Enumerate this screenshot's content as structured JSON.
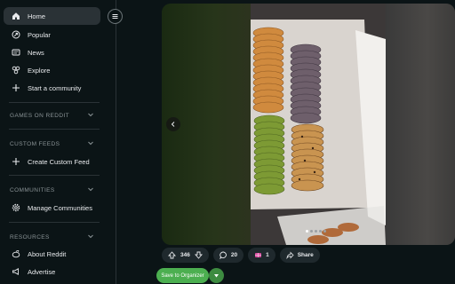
{
  "nav": {
    "home": "Home",
    "popular": "Popular",
    "news": "News",
    "explore": "Explore",
    "start_community": "Start a community"
  },
  "sections": {
    "games": "GAMES ON REDDIT",
    "custom_feeds": "CUSTOM FEEDS",
    "communities": "COMMUNITIES",
    "resources": "RESOURCES"
  },
  "custom_feeds": {
    "create": "Create Custom Feed"
  },
  "communities": {
    "manage": "Manage Communities"
  },
  "resources": {
    "about": "About Reddit",
    "advertise": "Advertise"
  },
  "post": {
    "upvotes": "346",
    "comments": "20",
    "awards": "1",
    "share": "Share",
    "gallery_total": 5,
    "gallery_current": 1
  },
  "extension": {
    "save": "Save to Organizer"
  },
  "colors": {
    "accent_green": "#4caf50",
    "active_nav": "#2a3236"
  }
}
